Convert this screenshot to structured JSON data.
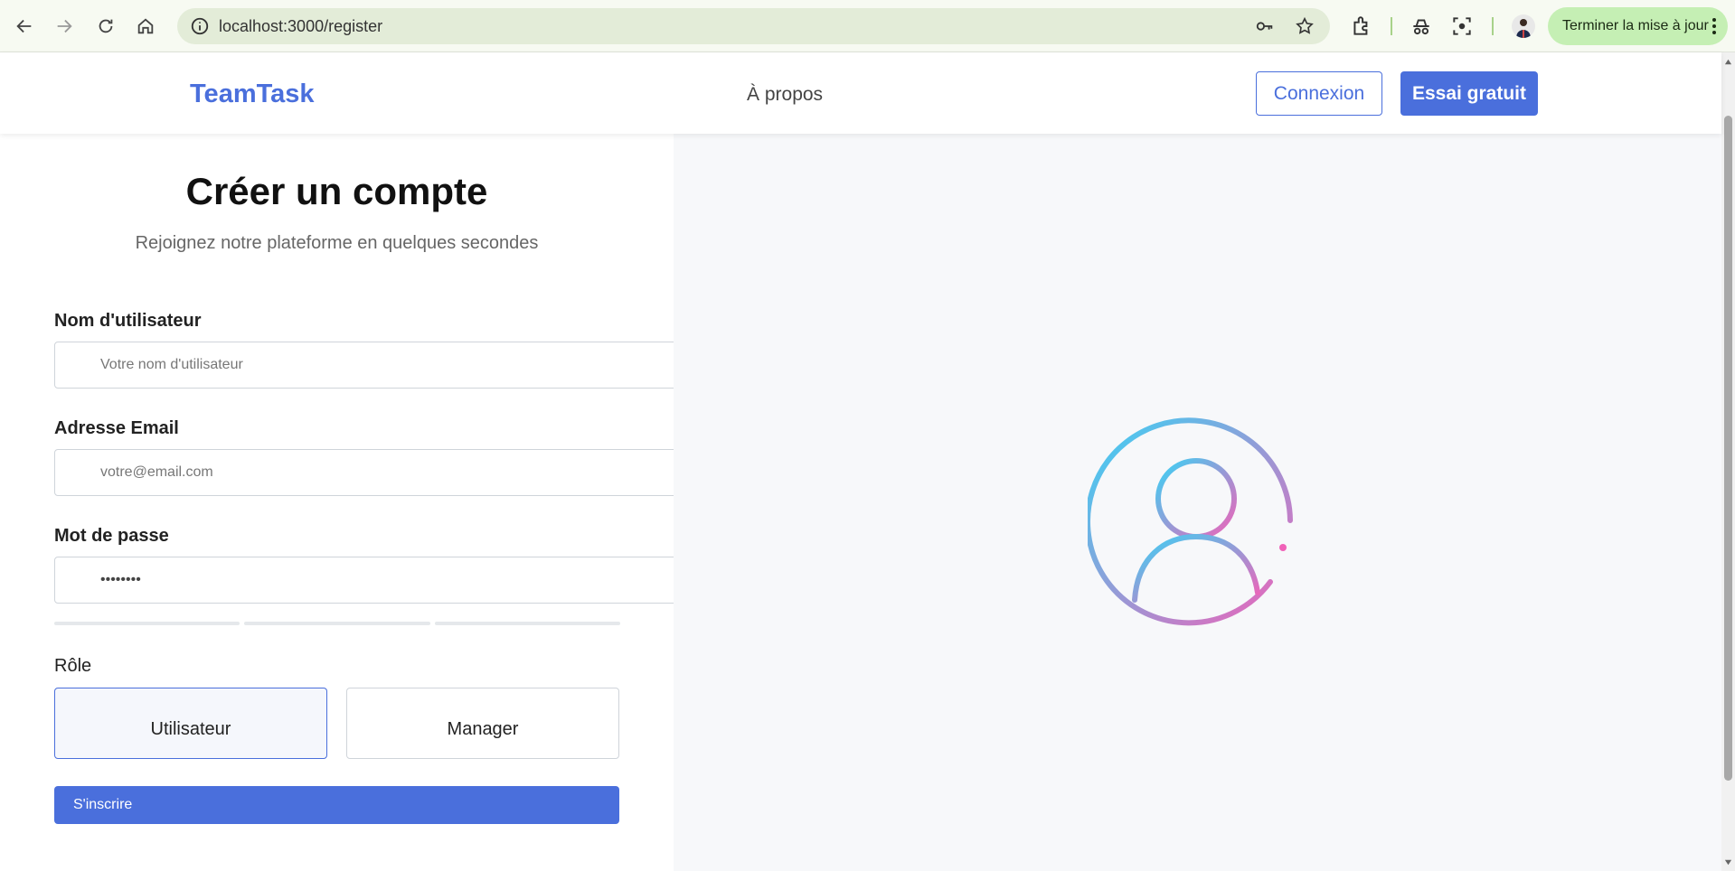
{
  "browser": {
    "url": "localhost:3000/register",
    "update_button_label": "Terminer la mise à jour"
  },
  "header": {
    "logo": "TeamTask",
    "nav_link": "À propos",
    "login_label": "Connexion",
    "trial_label": "Essai gratuit",
    "accent_color": "#4a6fdc"
  },
  "form": {
    "title": "Créer un compte",
    "subtitle": "Rejoignez notre plateforme en quelques secondes",
    "username": {
      "label": "Nom d'utilisateur",
      "placeholder": "Votre nom d'utilisateur"
    },
    "email": {
      "label": "Adresse Email",
      "placeholder": "votre@email.com"
    },
    "password": {
      "label": "Mot de passe",
      "value": "••••••••"
    },
    "role": {
      "label": "Rôle",
      "options": [
        "Utilisateur",
        "Manager"
      ],
      "selected": "Utilisateur"
    },
    "submit_label": "S'inscrire"
  },
  "illustration": {
    "icon": "user-circle-icon",
    "gradient": [
      "#3ad3f5",
      "#f062b8"
    ]
  }
}
